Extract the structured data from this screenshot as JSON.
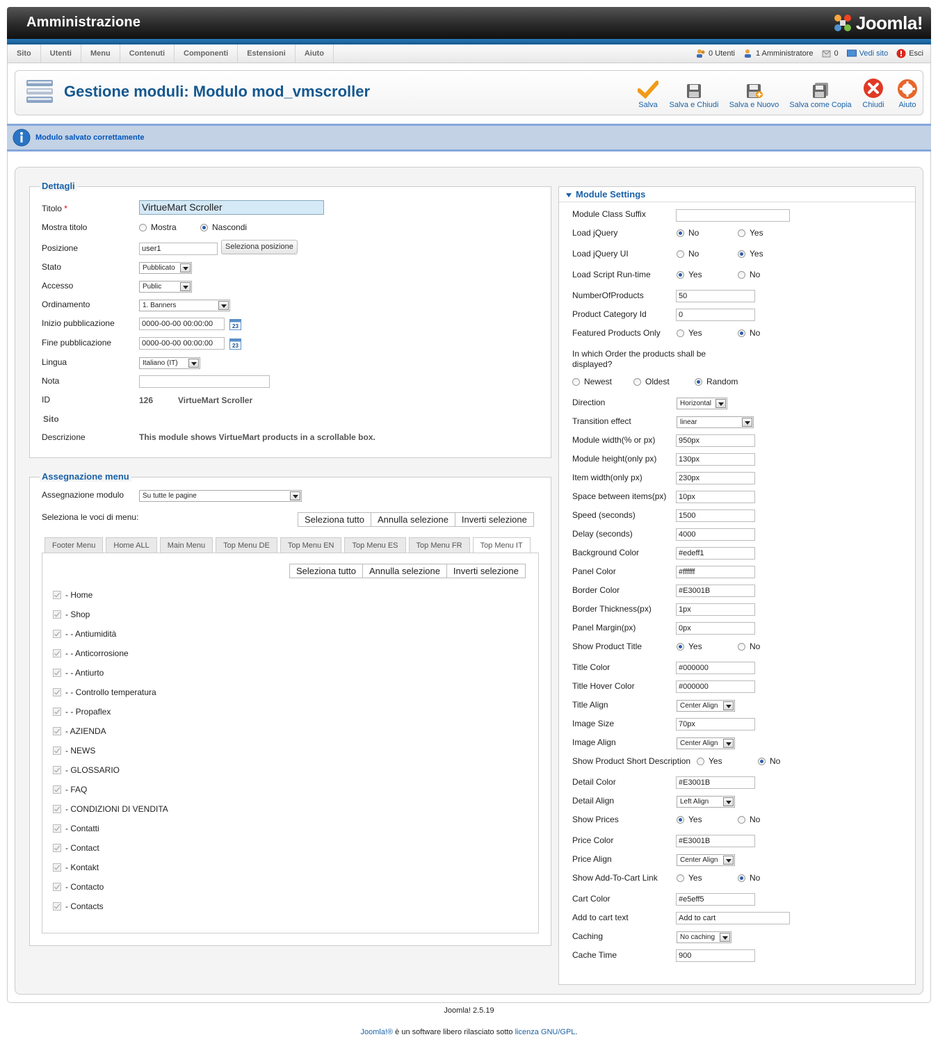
{
  "header": {
    "admin_title": "Amministrazione",
    "logo_text": "Joomla!"
  },
  "menubar": {
    "items": [
      "Sito",
      "Utenti",
      "Menu",
      "Contenuti",
      "Componenti",
      "Estensioni",
      "Aiuto"
    ],
    "status": {
      "users": "0 Utenti",
      "admins": "1 Amministratore",
      "messages": "0",
      "view_site": "Vedi sito",
      "logout": "Esci"
    }
  },
  "toolbar": {
    "title": "Gestione moduli: Modulo mod_vmscroller",
    "save": "Salva",
    "save_close": "Salva e Chiudi",
    "save_new": "Salva e Nuovo",
    "save_copy": "Salva come Copia",
    "close": "Chiudi",
    "help": "Aiuto"
  },
  "message": {
    "text": "Modulo salvato correttamente"
  },
  "details": {
    "legend": "Dettagli",
    "title_label": "Titolo",
    "title_required": "*",
    "title_value": "VirtueMart  Scroller",
    "show_title_label": "Mostra titolo",
    "show_option": "Mostra",
    "hide_option": "Nascondi",
    "position_label": "Posizione",
    "position_value": "user1",
    "position_button": "Seleziona posizione",
    "state_label": "Stato",
    "state_value": "Pubblicato",
    "access_label": "Accesso",
    "access_value": "Public",
    "ordering_label": "Ordinamento",
    "ordering_value": "1. Banners",
    "publish_up_label": "Inizio pubblicazione",
    "publish_up_value": "0000-00-00 00:00:00",
    "publish_down_label": "Fine pubblicazione",
    "publish_down_value": "0000-00-00 00:00:00",
    "calendar_day": "23",
    "language_label": "Lingua",
    "language_value": "Italiano (IT)",
    "note_label": "Nota",
    "note_value": "",
    "id_label": "ID",
    "id_value": "126",
    "module_name": "VirtueMart  Scroller",
    "site_label": "Sito",
    "description_label": "Descrizione",
    "description_value": "This module shows VirtueMart products in a scrollable box."
  },
  "menu_assignment": {
    "legend": "Assegnazione menu",
    "assign_label": "Assegnazione modulo",
    "assign_value": "Su tutte le pagine",
    "select_items_label": "Seleziona le voci di menu:",
    "select_all": "Seleziona tutto",
    "deselect": "Annulla selezione",
    "invert": "Inverti selezione",
    "tabs": [
      "Footer Menu",
      "Home ALL",
      "Main Menu",
      "Top Menu DE",
      "Top Menu EN",
      "Top Menu ES",
      "Top Menu FR",
      "Top Menu IT"
    ],
    "items": [
      "- Home",
      "- Shop",
      "- - Antiumidità",
      "- - Anticorrosione",
      "- - Antiurto",
      "- - Controllo temperatura",
      "- - Propaflex",
      "- AZIENDA",
      "- NEWS",
      "- GLOSSARIO",
      "- FAQ",
      "- CONDIZIONI DI VENDITA",
      "- Contatti",
      "- Contact",
      "- Kontakt",
      "- Contacto",
      "- Contacts"
    ]
  },
  "settings": {
    "header": "Module Settings",
    "class_suffix_label": "Module Class Suffix",
    "class_suffix_value": "",
    "load_jquery_label": "Load jQuery",
    "load_jquery_ui_label": "Load jQuery UI",
    "load_script_label": "Load Script Run-time",
    "yes": "Yes",
    "no": "No",
    "num_products_label": "NumberOfProducts",
    "num_products_value": "50",
    "category_label": "Product Category Id",
    "category_value": "0",
    "featured_label": "Featured Products Only",
    "order_label": "In which Order the products shall be displayed?",
    "newest": "Newest",
    "oldest": "Oldest",
    "random": "Random",
    "direction_label": "Direction",
    "direction_value": "Horizontal",
    "transition_label": "Transition effect",
    "transition_value": "linear",
    "width_label": "Module width(% or px)",
    "width_value": "950px",
    "height_label": "Module height(only px)",
    "height_value": "130px",
    "item_width_label": "Item width(only px)",
    "item_width_value": "230px",
    "space_label": "Space between items(px)",
    "space_value": "10px",
    "speed_label": "Speed (seconds)",
    "speed_value": "1500",
    "delay_label": "Delay (seconds)",
    "delay_value": "4000",
    "bg_color_label": "Background Color",
    "bg_color_value": "#edeff1",
    "panel_color_label": "Panel Color",
    "panel_color_value": "#ffffff",
    "border_color_label": "Border Color",
    "border_color_value": "#E3001B",
    "border_thick_label": "Border Thickness(px)",
    "border_thick_value": "1px",
    "panel_margin_label": "Panel Margin(px)",
    "panel_margin_value": "0px",
    "show_title_label": "Show Product Title",
    "title_color_label": "Title Color",
    "title_color_value": "#000000",
    "title_hover_label": "Title Hover Color",
    "title_hover_value": "#000000",
    "title_align_label": "Title Align",
    "title_align_value": "Center Align",
    "image_size_label": "Image Size",
    "image_size_value": "70px",
    "image_align_label": "Image Align",
    "image_align_value": "Center Align",
    "short_desc_label": "Show Product Short Description",
    "detail_color_label": "Detail Color",
    "detail_color_value": "#E3001B",
    "detail_align_label": "Detail Align",
    "detail_align_value": "Left Align",
    "show_prices_label": "Show Prices",
    "price_color_label": "Price Color",
    "price_color_value": "#E3001B",
    "price_align_label": "Price Align",
    "price_align_value": "Center Align",
    "cart_link_label": "Show Add-To-Cart Link",
    "cart_color_label": "Cart Color",
    "cart_color_value": "#e5eff5",
    "cart_text_label": "Add to cart text",
    "cart_text_value": "Add to cart",
    "caching_label": "Caching",
    "caching_value": "No caching",
    "cache_time_label": "Cache Time",
    "cache_time_value": "900"
  },
  "footer": {
    "version": "Joomla! 2.5.19",
    "license_brand": "Joomla!®",
    "license_mid": " è un software libero rilasciato sotto ",
    "license_link": "licenza GNU/GPL",
    "license_end": "."
  }
}
